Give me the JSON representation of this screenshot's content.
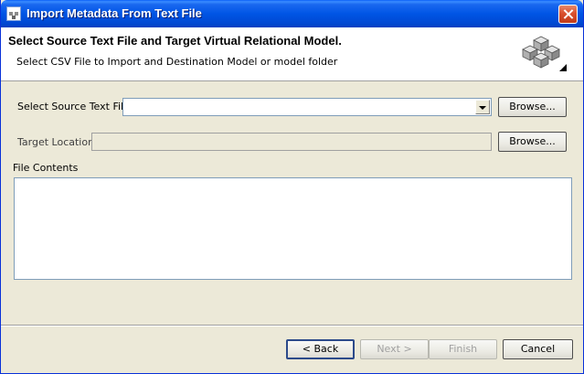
{
  "window": {
    "title": "Import Metadata From Text File"
  },
  "header": {
    "title": "Select Source Text File and Target Virtual Relational Model.",
    "subtitle": "Select CSV File to Import and Destination Model or model folder"
  },
  "form": {
    "source_label": "Select Source Text File",
    "source_value": "",
    "source_browse": "Browse...",
    "target_label": "Target Location",
    "target_value": "",
    "target_browse": "Browse...",
    "contents_label": "File Contents",
    "contents_value": ""
  },
  "footer": {
    "back": "< Back",
    "next": "Next >",
    "finish": "Finish",
    "cancel": "Cancel"
  },
  "icons": {
    "app": "app-icon",
    "close": "close-icon",
    "wizard": "cubes-icon",
    "dropdown": "chevron-down-icon"
  },
  "colors": {
    "titlebar": "#0055e5",
    "close": "#d9502e",
    "dialog_bg": "#ece9d8",
    "field_border": "#7f9db9"
  }
}
